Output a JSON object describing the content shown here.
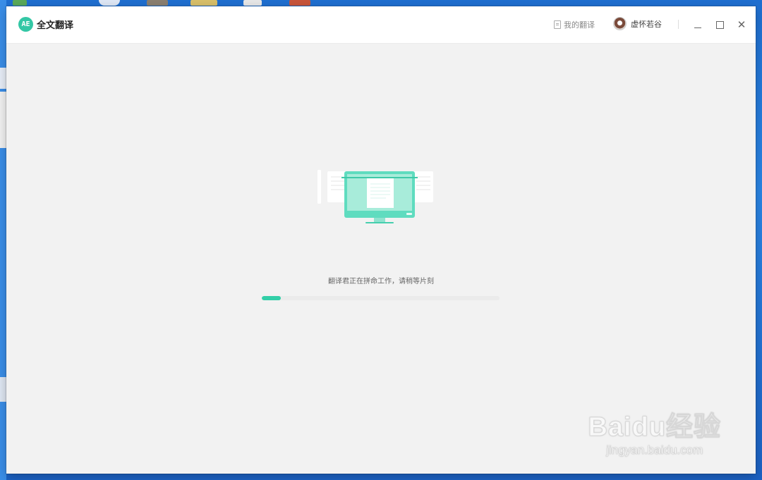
{
  "app": {
    "title": "全文翻译",
    "logo_text": "AE"
  },
  "header": {
    "my_translations_label": "我的翻译",
    "user_name": "虚怀若谷"
  },
  "main": {
    "status_text": "翻译君正在拼命工作，请稍等片刻",
    "progress_fraction": 0.08
  },
  "watermark": {
    "brand": "Baidu经验",
    "url": "jingyan.baidu.com"
  },
  "colors": {
    "accent": "#33cfa8",
    "window_bg": "#f2f2f2",
    "desktop_bg": "#2b86e6"
  },
  "icons": [
    "doc-icon",
    "avatar",
    "minimize-icon",
    "maximize-icon",
    "close-icon",
    "computer-illustration"
  ]
}
